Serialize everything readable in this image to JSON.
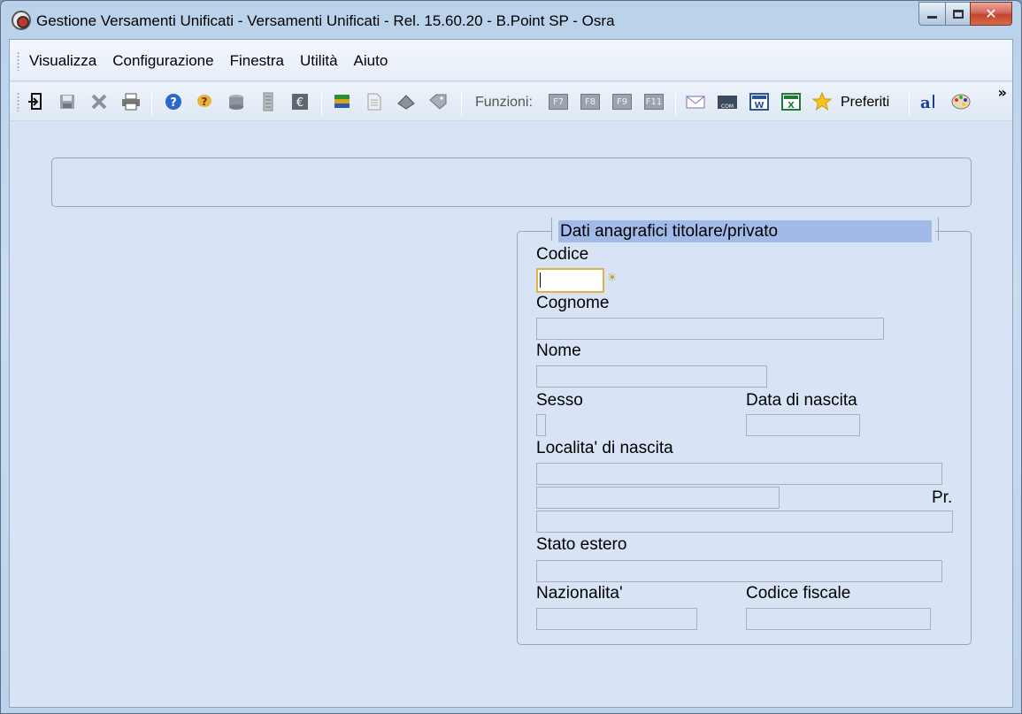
{
  "window": {
    "title": "Gestione Versamenti Unificati - Versamenti Unificati - Rel. 15.60.20 - B.Point SP - Osra",
    "buttons": {
      "minimize": "minimize-icon",
      "maximize": "maximize-icon",
      "close": "✕"
    }
  },
  "menu": {
    "items": [
      "Visualizza",
      "Configurazione",
      "Finestra",
      "Utilità",
      "Aiuto"
    ]
  },
  "toolbar": {
    "funzioni_label": "Funzioni:",
    "fkeys": [
      "F7",
      "F8",
      "F9",
      "F11"
    ],
    "preferiti_label": "Preferiti",
    "overflow": "»",
    "icons": [
      "exit-icon",
      "save-icon",
      "delete-icon",
      "print-icon",
      "help-icon",
      "hint-icon",
      "archive-icon",
      "document-stack-icon",
      "euro-icon",
      "books-icon",
      "page-icon",
      "stamp-icon",
      "tag-icon",
      "mail-icon",
      "com-icon",
      "word-icon",
      "excel-icon",
      "star-icon",
      "font-icon",
      "palette-icon"
    ]
  },
  "form": {
    "group_title": "Dati anagrafici titolare/privato",
    "codice_label": "Codice",
    "codice_value": "",
    "cognome_label": "Cognome",
    "nome_label": "Nome",
    "sesso_label": "Sesso",
    "data_nascita_label": "Data di nascita",
    "localita_label": "Localita' di nascita",
    "pr_label": "Pr.",
    "stato_estero_label": "Stato estero",
    "nazionalita_label": "Nazionalita'",
    "codice_fiscale_label": "Codice fiscale"
  },
  "colors": {
    "client_bg": "#d8e4f6",
    "group_title_bg": "#a2bae8",
    "active_field_border": "#e1b24a"
  }
}
